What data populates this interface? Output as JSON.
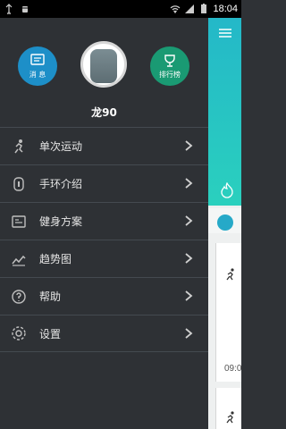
{
  "status_bar": {
    "time": "18:04"
  },
  "drawer": {
    "username": "龙90",
    "buttons": {
      "message_label": "消 息",
      "ranking_label": "排行榜"
    },
    "menu": [
      {
        "label": "单次运动",
        "icon": "run-icon"
      },
      {
        "label": "手环介绍",
        "icon": "band-icon"
      },
      {
        "label": "健身方案",
        "icon": "plan-icon"
      },
      {
        "label": "趋势图",
        "icon": "trend-icon"
      },
      {
        "label": "帮助",
        "icon": "help-icon"
      },
      {
        "label": "设置",
        "icon": "gear-icon"
      }
    ]
  },
  "content": {
    "card_time": "09:0"
  },
  "colors": {
    "drawer_bg": "#2e3135",
    "message_button": "#1d8fc8",
    "ranking_button": "#1a9a73",
    "accent_teal": "#2ad0be"
  }
}
